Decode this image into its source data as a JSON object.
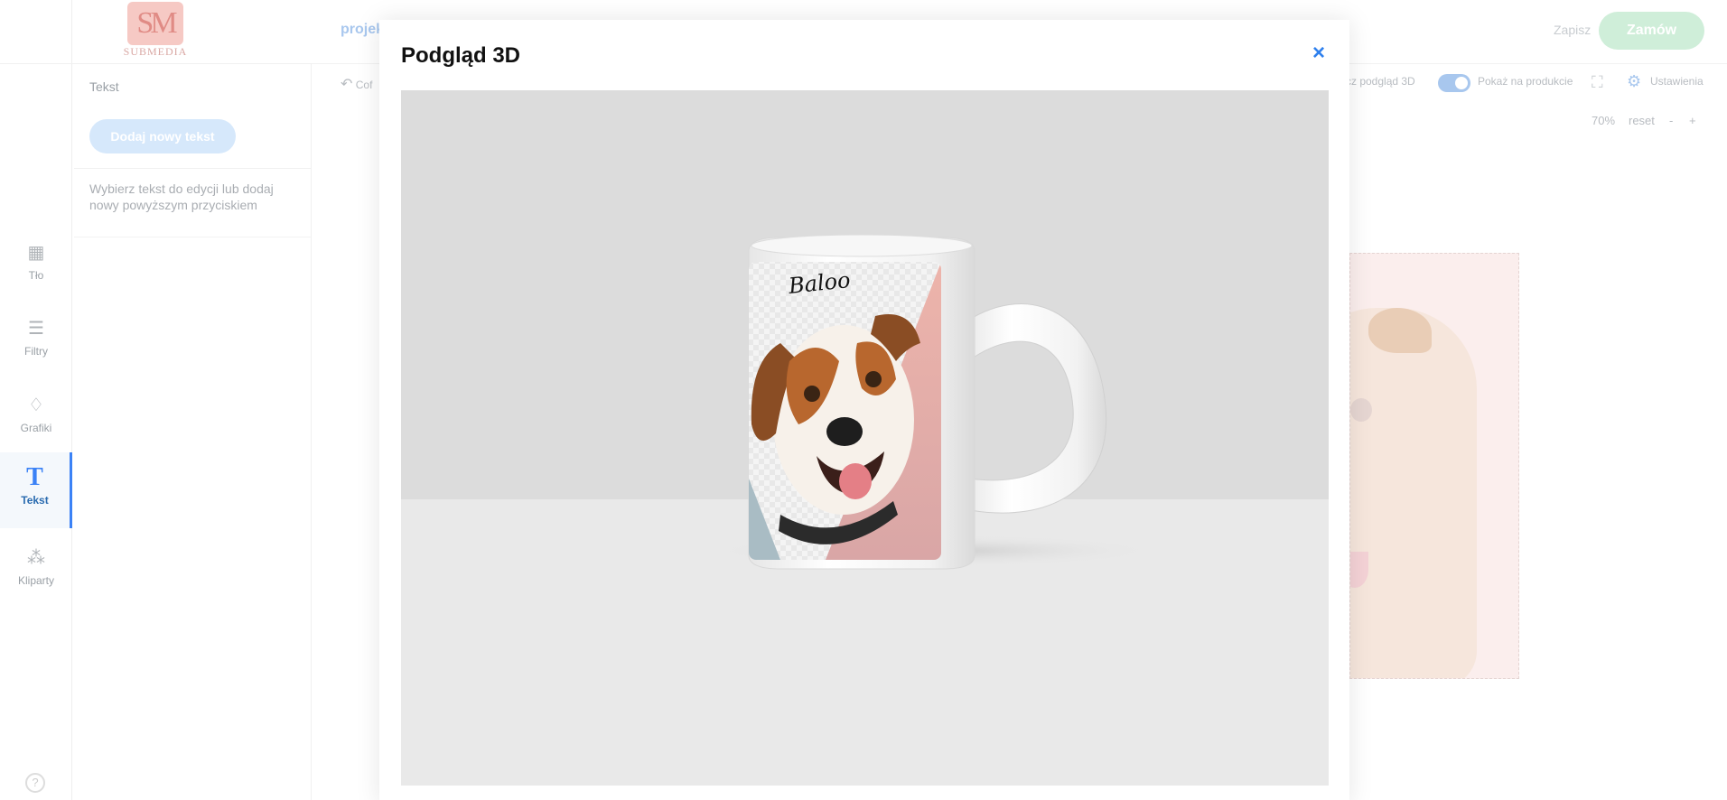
{
  "brand": {
    "logo_letters": "SM",
    "logo_text": "SUBMEDIA"
  },
  "sidebar": {
    "items": [
      {
        "label": "Tło",
        "icon": "background-pattern-icon"
      },
      {
        "label": "Filtry",
        "icon": "sliders-icon"
      },
      {
        "label": "Grafiki",
        "icon": "drop-icon"
      },
      {
        "label": "Tekst",
        "icon": "text-t-icon",
        "active": true
      },
      {
        "label": "Kliparty",
        "icon": "shapes-icon"
      }
    ],
    "help": "?"
  },
  "text_panel": {
    "title": "Tekst",
    "add_button": "Dodaj nowy tekst",
    "hint": "Wybierz tekst do edycji lub dodaj nowy powyższym przyciskiem"
  },
  "header": {
    "project": "projek",
    "undo": "Cof",
    "save": "Zapisz",
    "order": "Zamów"
  },
  "toolbar": {
    "preview_3d": "cz podgląd 3D",
    "show_in_production": "Pokaż na produkcie",
    "show_in_production_on": true,
    "settings": "Ustawienia"
  },
  "zoom": {
    "level": "70%",
    "reset": "reset",
    "minus": "-",
    "plus": "+"
  },
  "modal": {
    "title": "Podgląd 3D",
    "close": "×",
    "mug_text": "Baloo"
  },
  "colors": {
    "accent": "#2f80ed",
    "order_button": "#cfeed9",
    "mug_pink": "#e7a9a1"
  }
}
